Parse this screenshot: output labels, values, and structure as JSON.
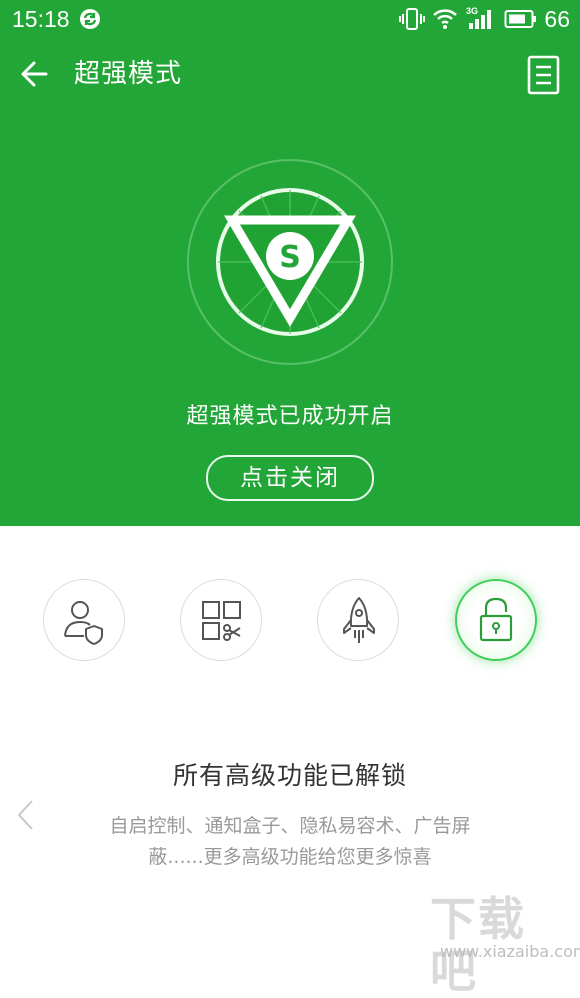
{
  "status_bar": {
    "time": "15:18",
    "battery": "66",
    "network": "3G"
  },
  "header": {
    "title": "超强模式"
  },
  "hero": {
    "emblem_letter": "S",
    "status_text": "超强模式已成功开启",
    "close_button_label": "点击关闭"
  },
  "features": [
    {
      "icon": "user-shield-icon",
      "active": false
    },
    {
      "icon": "app-grid-scissors-icon",
      "active": false
    },
    {
      "icon": "rocket-icon",
      "active": false
    },
    {
      "icon": "unlock-icon",
      "active": true
    }
  ],
  "feature_detail": {
    "title": "所有高级功能已解锁",
    "description": "自启控制、通知盒子、隐私易容术、广告屏蔽......更多高级功能给您更多惊喜"
  },
  "watermark": {
    "main": "下载吧",
    "sub": "www.xiazaiba.com"
  },
  "colors": {
    "primary_green": "#22a637",
    "active_ring": "#3ed05a",
    "title_text": "#333333",
    "desc_text": "#9a9a9a"
  }
}
